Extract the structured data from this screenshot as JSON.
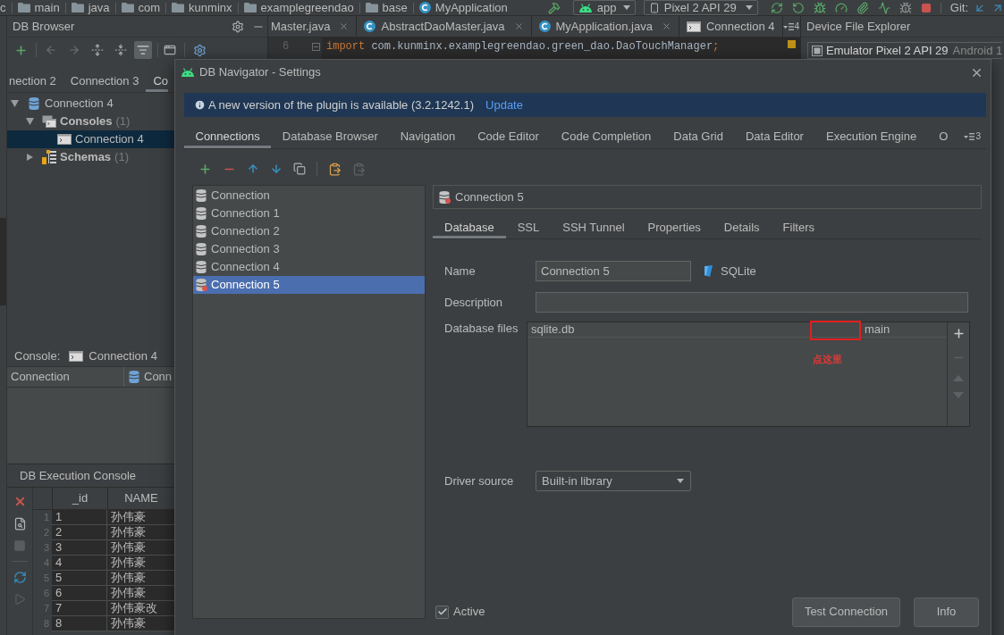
{
  "breadcrumb": [
    {
      "label": "c",
      "kind": "text"
    },
    {
      "label": "main",
      "kind": "folder"
    },
    {
      "label": "java",
      "kind": "folder"
    },
    {
      "label": "com",
      "kind": "folder"
    },
    {
      "label": "kunminx",
      "kind": "folder"
    },
    {
      "label": "examplegreendao",
      "kind": "folder"
    },
    {
      "label": "base",
      "kind": "folder"
    },
    {
      "label": "MyApplication",
      "kind": "class"
    }
  ],
  "run_toolbar": {
    "configuration": "app",
    "device": "Pixel 2 API 29",
    "vcs": "Git:"
  },
  "db_browser": {
    "title": "DB Browser",
    "tabs": [
      {
        "label": "nection 2",
        "selected": false
      },
      {
        "label": "Connection 3",
        "selected": false
      },
      {
        "label": "Co",
        "selected": true
      }
    ],
    "tree": [
      {
        "label": "Connection 4",
        "kind": "connection",
        "expanded": true,
        "selected": false,
        "children": [
          {
            "label": "Consoles",
            "count": "(1)",
            "kind": "consoles",
            "expanded": true,
            "selected": false,
            "children": [
              {
                "label": "Connection 4",
                "kind": "console",
                "selected": true
              }
            ]
          },
          {
            "label": "Schemas",
            "count": "(1)",
            "kind": "schemas",
            "expanded": false,
            "selected": false
          }
        ]
      }
    ],
    "console": {
      "label": "Console:",
      "value": "Connection 4"
    },
    "columns": [
      "Connection",
      "Conn"
    ]
  },
  "execution_console": {
    "title": "DB Execution Console",
    "columns": [
      "_id",
      "NAME"
    ],
    "rows": [
      {
        "number": "1",
        "id": "1",
        "name": "孙伟豪"
      },
      {
        "number": "2",
        "id": "2",
        "name": "孙伟豪"
      },
      {
        "number": "3",
        "id": "3",
        "name": "孙伟豪"
      },
      {
        "number": "4",
        "id": "4",
        "name": "孙伟豪"
      },
      {
        "number": "5",
        "id": "5",
        "name": "孙伟豪"
      },
      {
        "number": "6",
        "id": "6",
        "name": "孙伟豪"
      },
      {
        "number": "7",
        "id": "7",
        "name": "孙伟豪改"
      },
      {
        "number": "8",
        "id": "8",
        "name": "孙伟豪"
      }
    ]
  },
  "editor": {
    "tabs": [
      {
        "label": "Master.java",
        "kind": "file",
        "closable": true
      },
      {
        "label": "AbstractDaoMaster.java",
        "kind": "class",
        "closable": true
      },
      {
        "label": "MyApplication.java",
        "kind": "class",
        "closable": true
      },
      {
        "label": "Connection 4",
        "kind": "console",
        "closable": false
      }
    ],
    "overflow_count": "4",
    "line_number": "6",
    "code": [
      {
        "text": "import",
        "kind": "keyword"
      },
      {
        "text": " com.kunminx.examplegreendao.green_dao.DaoTouchManager",
        "kind": "plain"
      },
      {
        "text": ";",
        "kind": "keyword"
      }
    ]
  },
  "device_explorer": {
    "title": "Device File Explorer",
    "device": "Emulator Pixel 2 API 29",
    "device_detail": "Android 1"
  },
  "dialog": {
    "title": "DB Navigator - Settings",
    "banner": {
      "text": "A new version of the plugin is available (3.2.1242.1)",
      "link": "Update"
    },
    "tabs": [
      {
        "label": "Connections",
        "selected": true
      },
      {
        "label": "Database Browser",
        "selected": false
      },
      {
        "label": "Navigation",
        "selected": false
      },
      {
        "label": "Code Editor",
        "selected": false
      },
      {
        "label": "Code Completion",
        "selected": false
      },
      {
        "label": "Data Grid",
        "selected": false
      },
      {
        "label": "Data Editor",
        "selected": false
      },
      {
        "label": "Execution Engine",
        "selected": false
      },
      {
        "label": "O",
        "selected": false
      }
    ],
    "tab_overflow_count": "3",
    "connections": [
      {
        "label": "Connection",
        "kind": "saved",
        "selected": false
      },
      {
        "label": "Connection 1",
        "kind": "saved",
        "selected": false
      },
      {
        "label": "Connection 2",
        "kind": "saved",
        "selected": false
      },
      {
        "label": "Connection 3",
        "kind": "saved",
        "selected": false
      },
      {
        "label": "Connection 4",
        "kind": "saved",
        "selected": false
      },
      {
        "label": "Connection 5",
        "kind": "unsaved",
        "selected": true
      }
    ],
    "editor": {
      "title": "Connection 5",
      "tabs": [
        {
          "label": "Database",
          "selected": true
        },
        {
          "label": "SSL",
          "selected": false
        },
        {
          "label": "SSH Tunnel",
          "selected": false
        },
        {
          "label": "Properties",
          "selected": false
        },
        {
          "label": "Details",
          "selected": false
        },
        {
          "label": "Filters",
          "selected": false
        }
      ],
      "name": {
        "label": "Name",
        "value": "Connection 5"
      },
      "database_type": "SQLite",
      "description": {
        "label": "Description"
      },
      "database_files": {
        "label": "Database files",
        "rows": [
          {
            "file": "sqlite.db",
            "schema": "main"
          }
        ],
        "actions": [
          {
            "kind": "add",
            "disabled": false
          },
          {
            "kind": "remove",
            "disabled": true
          },
          {
            "kind": "up",
            "disabled": true
          },
          {
            "kind": "down",
            "disabled": true
          }
        ]
      },
      "annotation": "点这里",
      "driver_source": {
        "label": "Driver source",
        "value": "Built-in library"
      },
      "active": {
        "label": "Active",
        "checked": true
      }
    },
    "buttons": [
      "Test Connection",
      "Info"
    ]
  }
}
